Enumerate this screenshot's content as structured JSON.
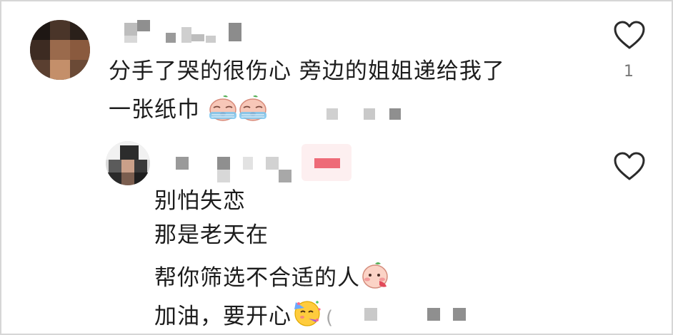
{
  "comment": {
    "lines": [
      "分手了哭的很伤心 旁边的姐姐递给我了",
      "一张纸巾"
    ],
    "emoji": [
      "crying-face-emoji",
      "crying-face-emoji"
    ],
    "like_count": "1"
  },
  "reply": {
    "lines": [
      "别怕失恋",
      "那是老天在",
      "帮你筛选不合适的人",
      "加油，要开心"
    ],
    "emoji": [
      "blush-peach-emoji",
      "party-face-emoji"
    ],
    "trailing_glyph": "("
  },
  "colors": {
    "heart_stroke": "#2b2b2b",
    "text": "#1c1c1c",
    "mosaic_gray": "#9e9e9e",
    "author_badge": "#ee6b78"
  }
}
